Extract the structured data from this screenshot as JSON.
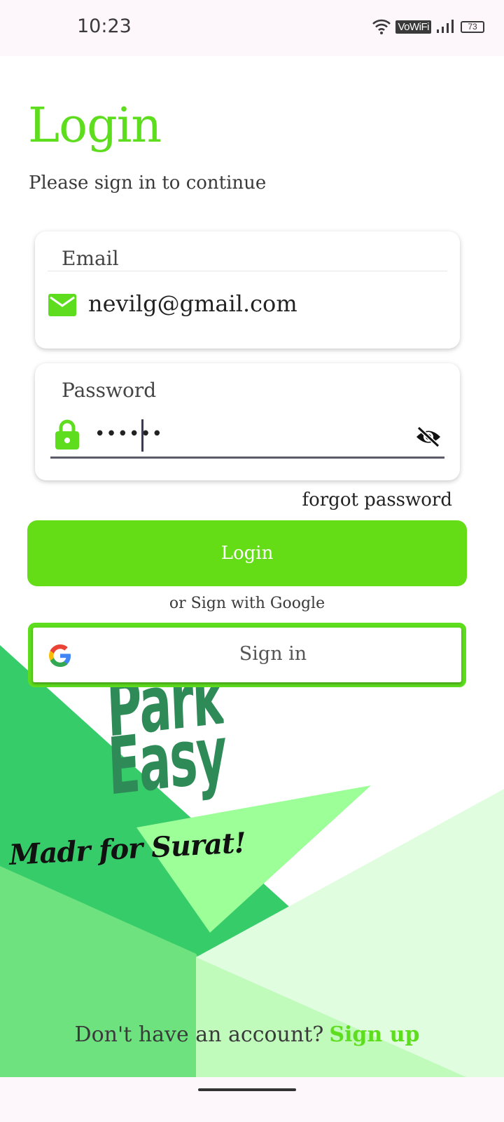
{
  "status_bar": {
    "time": "10:23",
    "vowifi": "VoWiFi",
    "battery": "73"
  },
  "login": {
    "title": "Login",
    "subtitle": "Please sign in to continue",
    "email_label": "Email",
    "email_value": "nevilg@gmail.com",
    "password_label": "Password",
    "password_value": "••••••",
    "forgot": "forgot password",
    "login_button": "Login",
    "or_text": "or Sign with Google",
    "google_button": "Sign in"
  },
  "branding": {
    "logo_line1": "Park",
    "logo_line2": "Easy",
    "tagline": "Madr for Surat!"
  },
  "footer": {
    "prompt": "Don't have an account?",
    "signup": "Sign up"
  },
  "colors": {
    "accent": "#5edd1e",
    "button": "#64dd17",
    "logo": "#2e8b57"
  },
  "icons": {
    "email": "mail-icon",
    "password": "lock-icon",
    "visibility": "eye-off-icon",
    "google": "google-icon"
  }
}
